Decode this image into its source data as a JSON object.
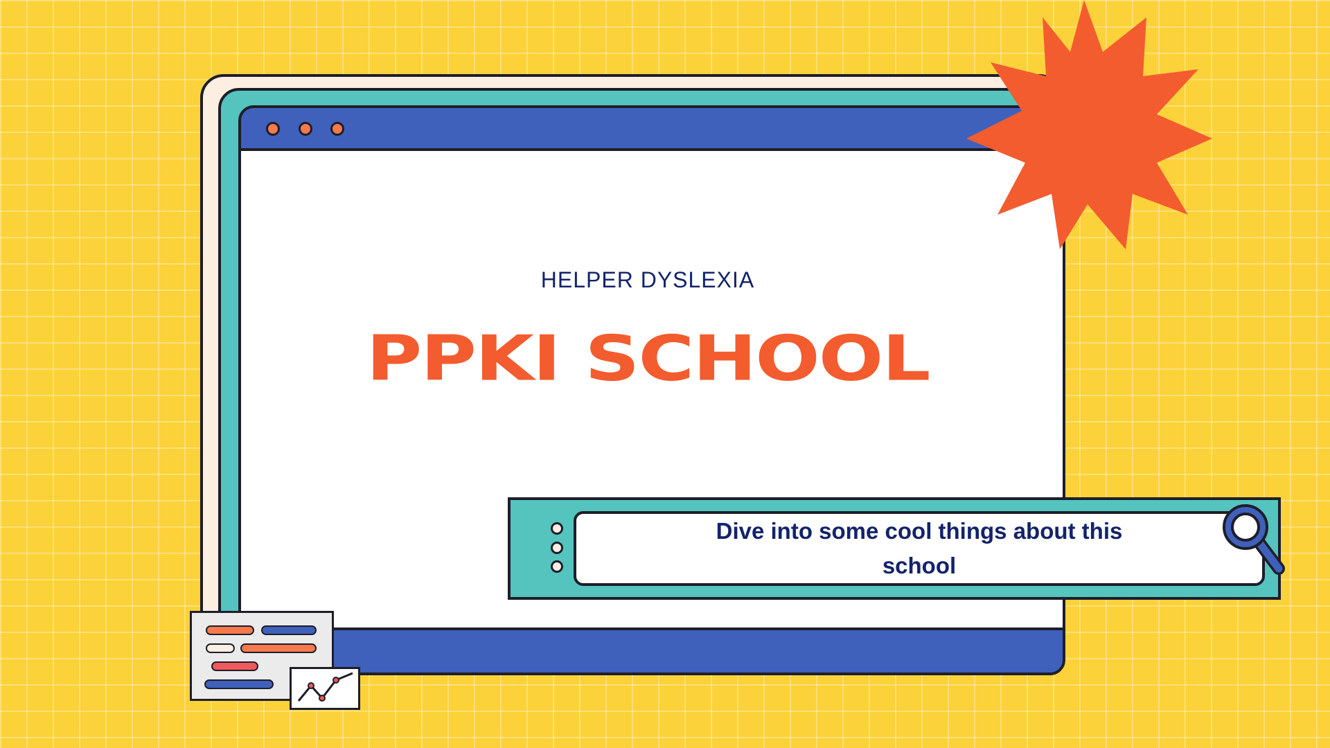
{
  "slide": {
    "subtitle": "HELPER DYSLEXIA",
    "title": "PPKI SCHOOL"
  },
  "search": {
    "text": "Dive into some cool things about this school"
  },
  "colors": {
    "background": "#fcd23a",
    "accent_orange": "#f35c2e",
    "blue": "#3f61bb",
    "teal": "#55c4be",
    "navy_text": "#13236b",
    "cream": "#fcefe2"
  },
  "icons": [
    "starburst-icon",
    "magnifier-icon",
    "line-chart-icon"
  ]
}
